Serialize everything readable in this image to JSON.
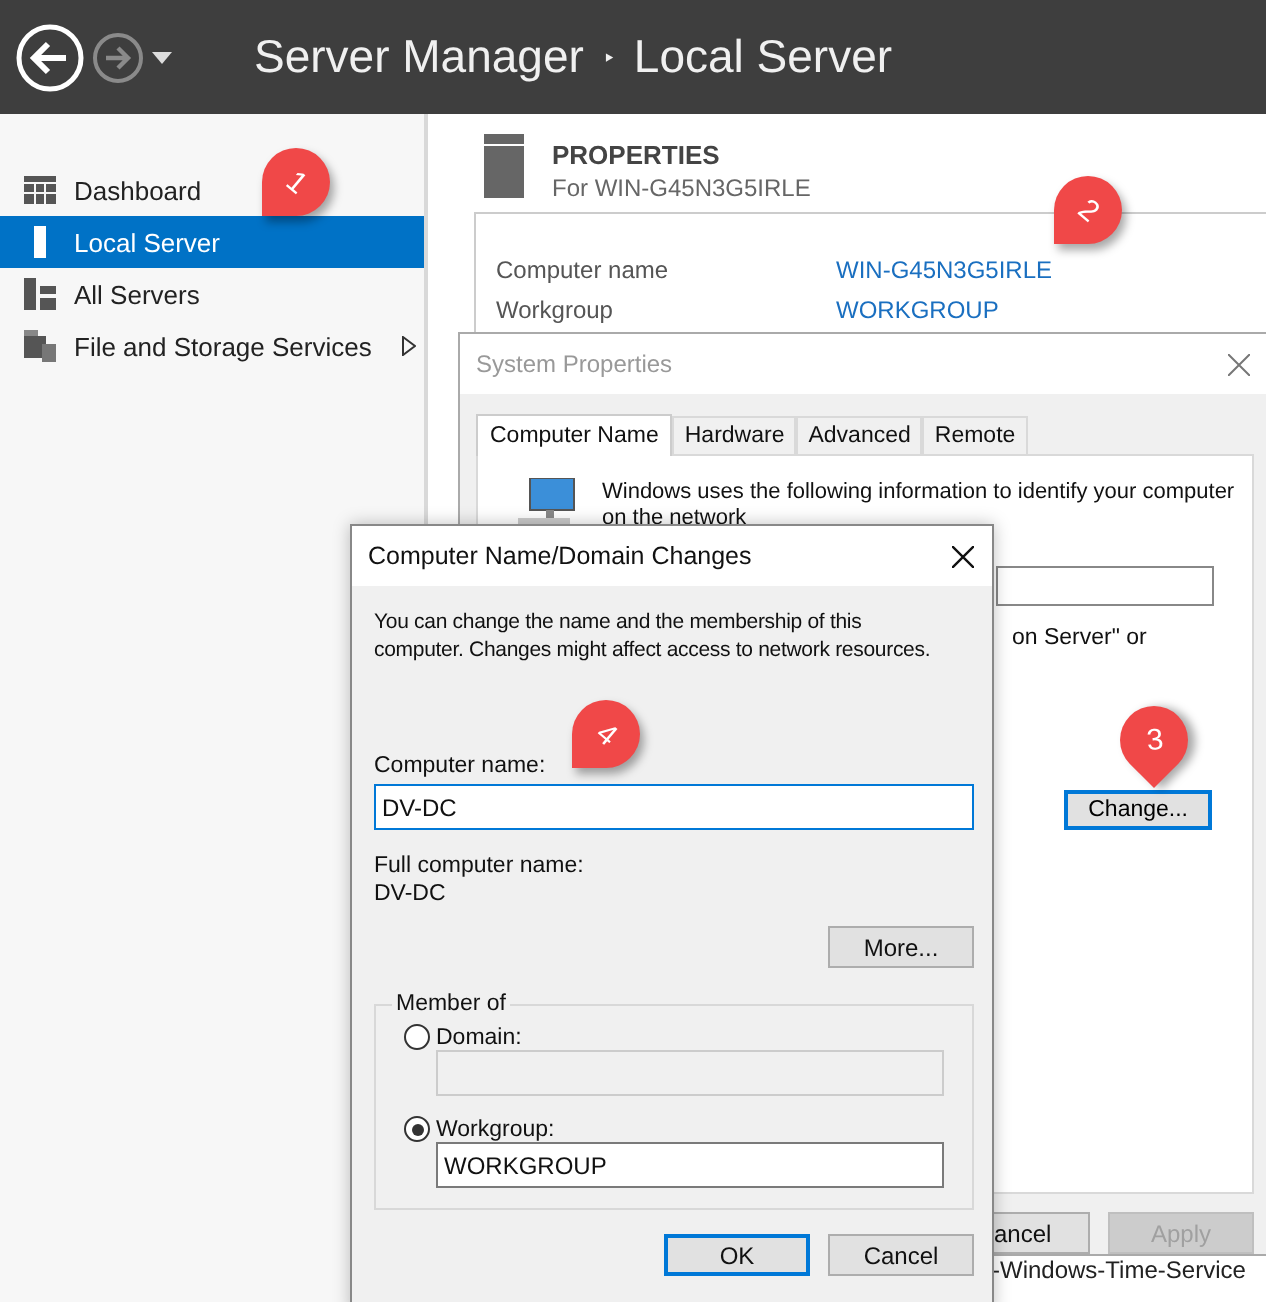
{
  "header": {
    "breadcrumb": [
      {
        "label": "Server Manager"
      },
      {
        "label": "Local Server"
      }
    ],
    "separator": "‣"
  },
  "sidebar": {
    "items": [
      {
        "label": "Dashboard",
        "kind": "dashboard",
        "selected": false,
        "expandable": false
      },
      {
        "label": "Local Server",
        "kind": "server",
        "selected": true,
        "expandable": false
      },
      {
        "label": "All Servers",
        "kind": "servers",
        "selected": false,
        "expandable": false
      },
      {
        "label": "File and Storage Services",
        "kind": "storage",
        "selected": false,
        "expandable": true
      }
    ]
  },
  "properties": {
    "title": "PROPERTIES",
    "subtitle": "For WIN-G45N3G5IRLE",
    "rows": [
      {
        "label": "Computer name",
        "value": "WIN-G45N3G5IRLE"
      },
      {
        "label": "Workgroup",
        "value": "WORKGROUP"
      }
    ],
    "background_text": "-Windows-Time-Service"
  },
  "system_properties": {
    "title": "System Properties",
    "tabs": [
      {
        "label": "Computer Name",
        "selected": true
      },
      {
        "label": "Hardware",
        "selected": false
      },
      {
        "label": "Advanced",
        "selected": false
      },
      {
        "label": "Remote",
        "selected": false
      }
    ],
    "description": "Windows uses the following information to identify your computer",
    "description_line_2": "on the network",
    "text_fragment": "on Server\" or",
    "change_button": {
      "label": "Change...",
      "focused": true
    },
    "buttons": [
      {
        "label": "ancel",
        "disabled": false
      },
      {
        "label": "Apply",
        "disabled": true
      }
    ]
  },
  "dialog": {
    "title": "Computer Name/Domain Changes",
    "intro": "You can change the name and the membership of this computer. Changes might affect access to network resources.",
    "computer_name": {
      "label": "Computer name:",
      "value": "DV-DC"
    },
    "full_name": {
      "label": "Full computer name:",
      "value": "DV-DC"
    },
    "more_button": "More...",
    "member_of": {
      "legend": "Member of",
      "options": [
        {
          "label": "Domain:",
          "selected": false
        },
        {
          "label": "Workgroup:",
          "selected": true,
          "value": "WORKGROUP"
        }
      ]
    },
    "buttons": [
      {
        "label": "OK",
        "default": true
      },
      {
        "label": "Cancel",
        "default": false
      }
    ]
  },
  "pins": [
    {
      "number": "1"
    },
    {
      "number": "2"
    },
    {
      "number": "3"
    },
    {
      "number": "4"
    }
  ]
}
